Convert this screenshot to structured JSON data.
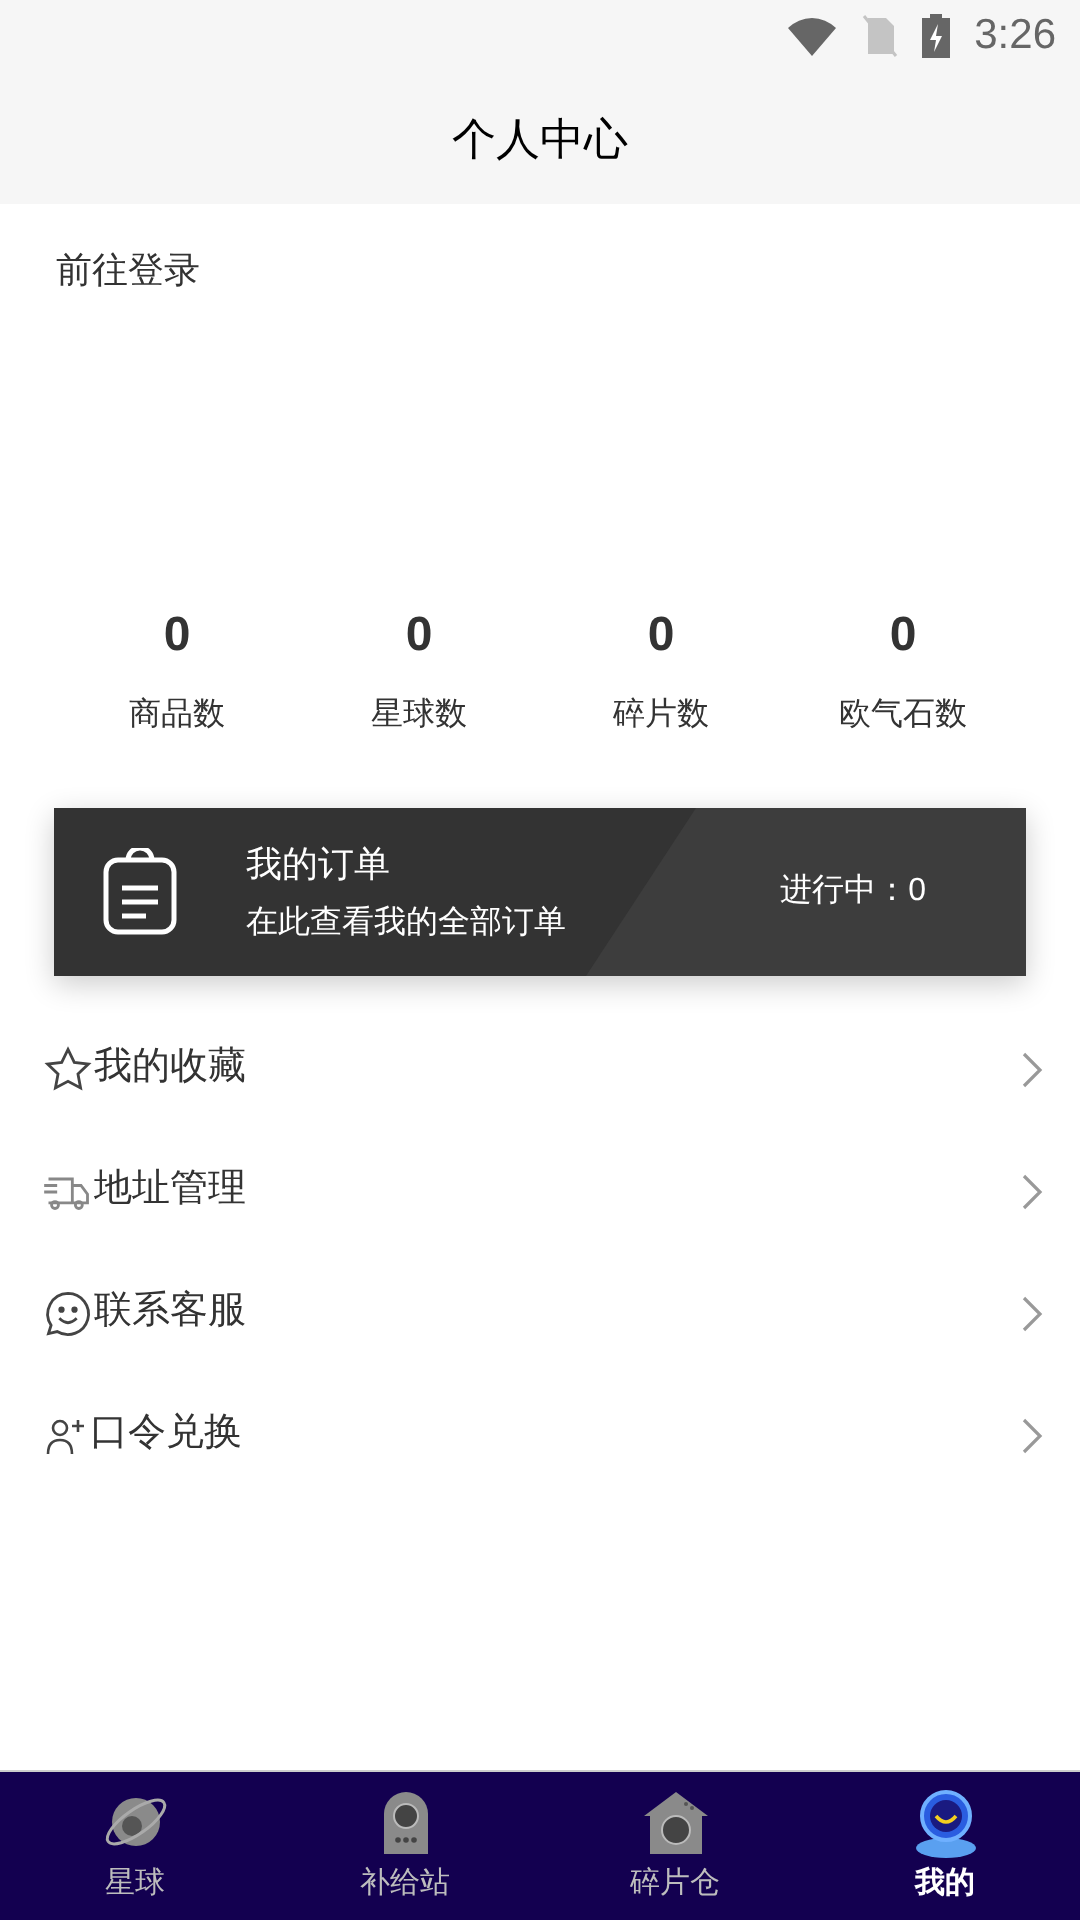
{
  "status_bar": {
    "time": "3:26"
  },
  "header": {
    "title": "个人中心"
  },
  "login_link": "前往登录",
  "stats": [
    {
      "value": "0",
      "label": "商品数"
    },
    {
      "value": "0",
      "label": "星球数"
    },
    {
      "value": "0",
      "label": "碎片数"
    },
    {
      "value": "0",
      "label": "欧气石数"
    }
  ],
  "order_card": {
    "title": "我的订单",
    "subtitle": "在此查看我的全部订单",
    "status": "进行中：0"
  },
  "menu": [
    {
      "kind": "star",
      "label": "我的收藏"
    },
    {
      "kind": "truck",
      "label": "地址管理"
    },
    {
      "kind": "smile",
      "label": "联系客服"
    },
    {
      "kind": "user-plus",
      "label": "口令兑换"
    }
  ],
  "tabs": [
    {
      "kind": "planet",
      "label": "星球",
      "selected": false
    },
    {
      "kind": "station",
      "label": "补给站",
      "selected": false
    },
    {
      "kind": "house",
      "label": "碎片仓",
      "selected": false
    },
    {
      "kind": "person",
      "label": "我的",
      "selected": true
    }
  ]
}
